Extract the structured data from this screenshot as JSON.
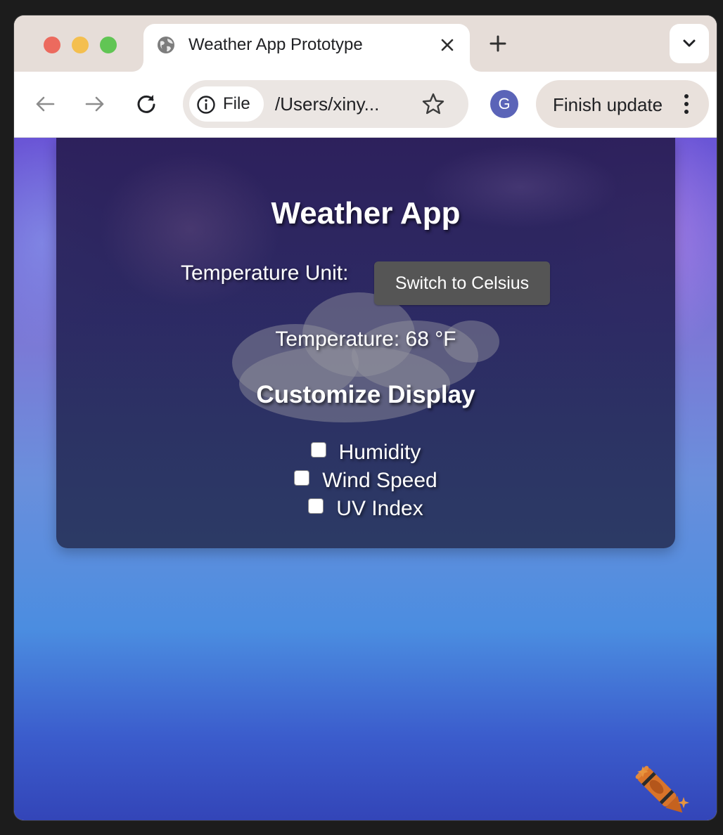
{
  "browser": {
    "tab_title": "Weather App Prototype",
    "url_chip_label": "File",
    "url_text": "/Users/xiny...",
    "profile_initial": "G",
    "update_button_label": "Finish update"
  },
  "app": {
    "title": "Weather App",
    "temperature_unit_label": "Temperature Unit:",
    "switch_button_label": "Switch to Celsius",
    "temperature_label": "Temperature:",
    "temperature_value": "68",
    "temperature_unit": "°F",
    "customize_title": "Customize Display",
    "options": [
      {
        "label": "Humidity",
        "checked": false
      },
      {
        "label": "Wind Speed",
        "checked": false
      },
      {
        "label": "UV Index",
        "checked": false
      }
    ]
  },
  "colors": {
    "card_background": "#2a2456",
    "button_background": "#555555",
    "page_gradient_top": "#6a55d6",
    "page_gradient_bottom": "#3345b8",
    "avatar": "#5b64b8"
  },
  "icons": {
    "favicon": "globe-icon",
    "close": "close-icon",
    "new_tab": "plus-icon",
    "tab_search": "chevron-down-icon",
    "back": "arrow-left-icon",
    "forward": "arrow-right-icon",
    "reload": "reload-icon",
    "site_info": "info-icon",
    "bookmark": "star-icon",
    "menu": "kebab-menu-icon",
    "decoration": "crayon-icon"
  }
}
